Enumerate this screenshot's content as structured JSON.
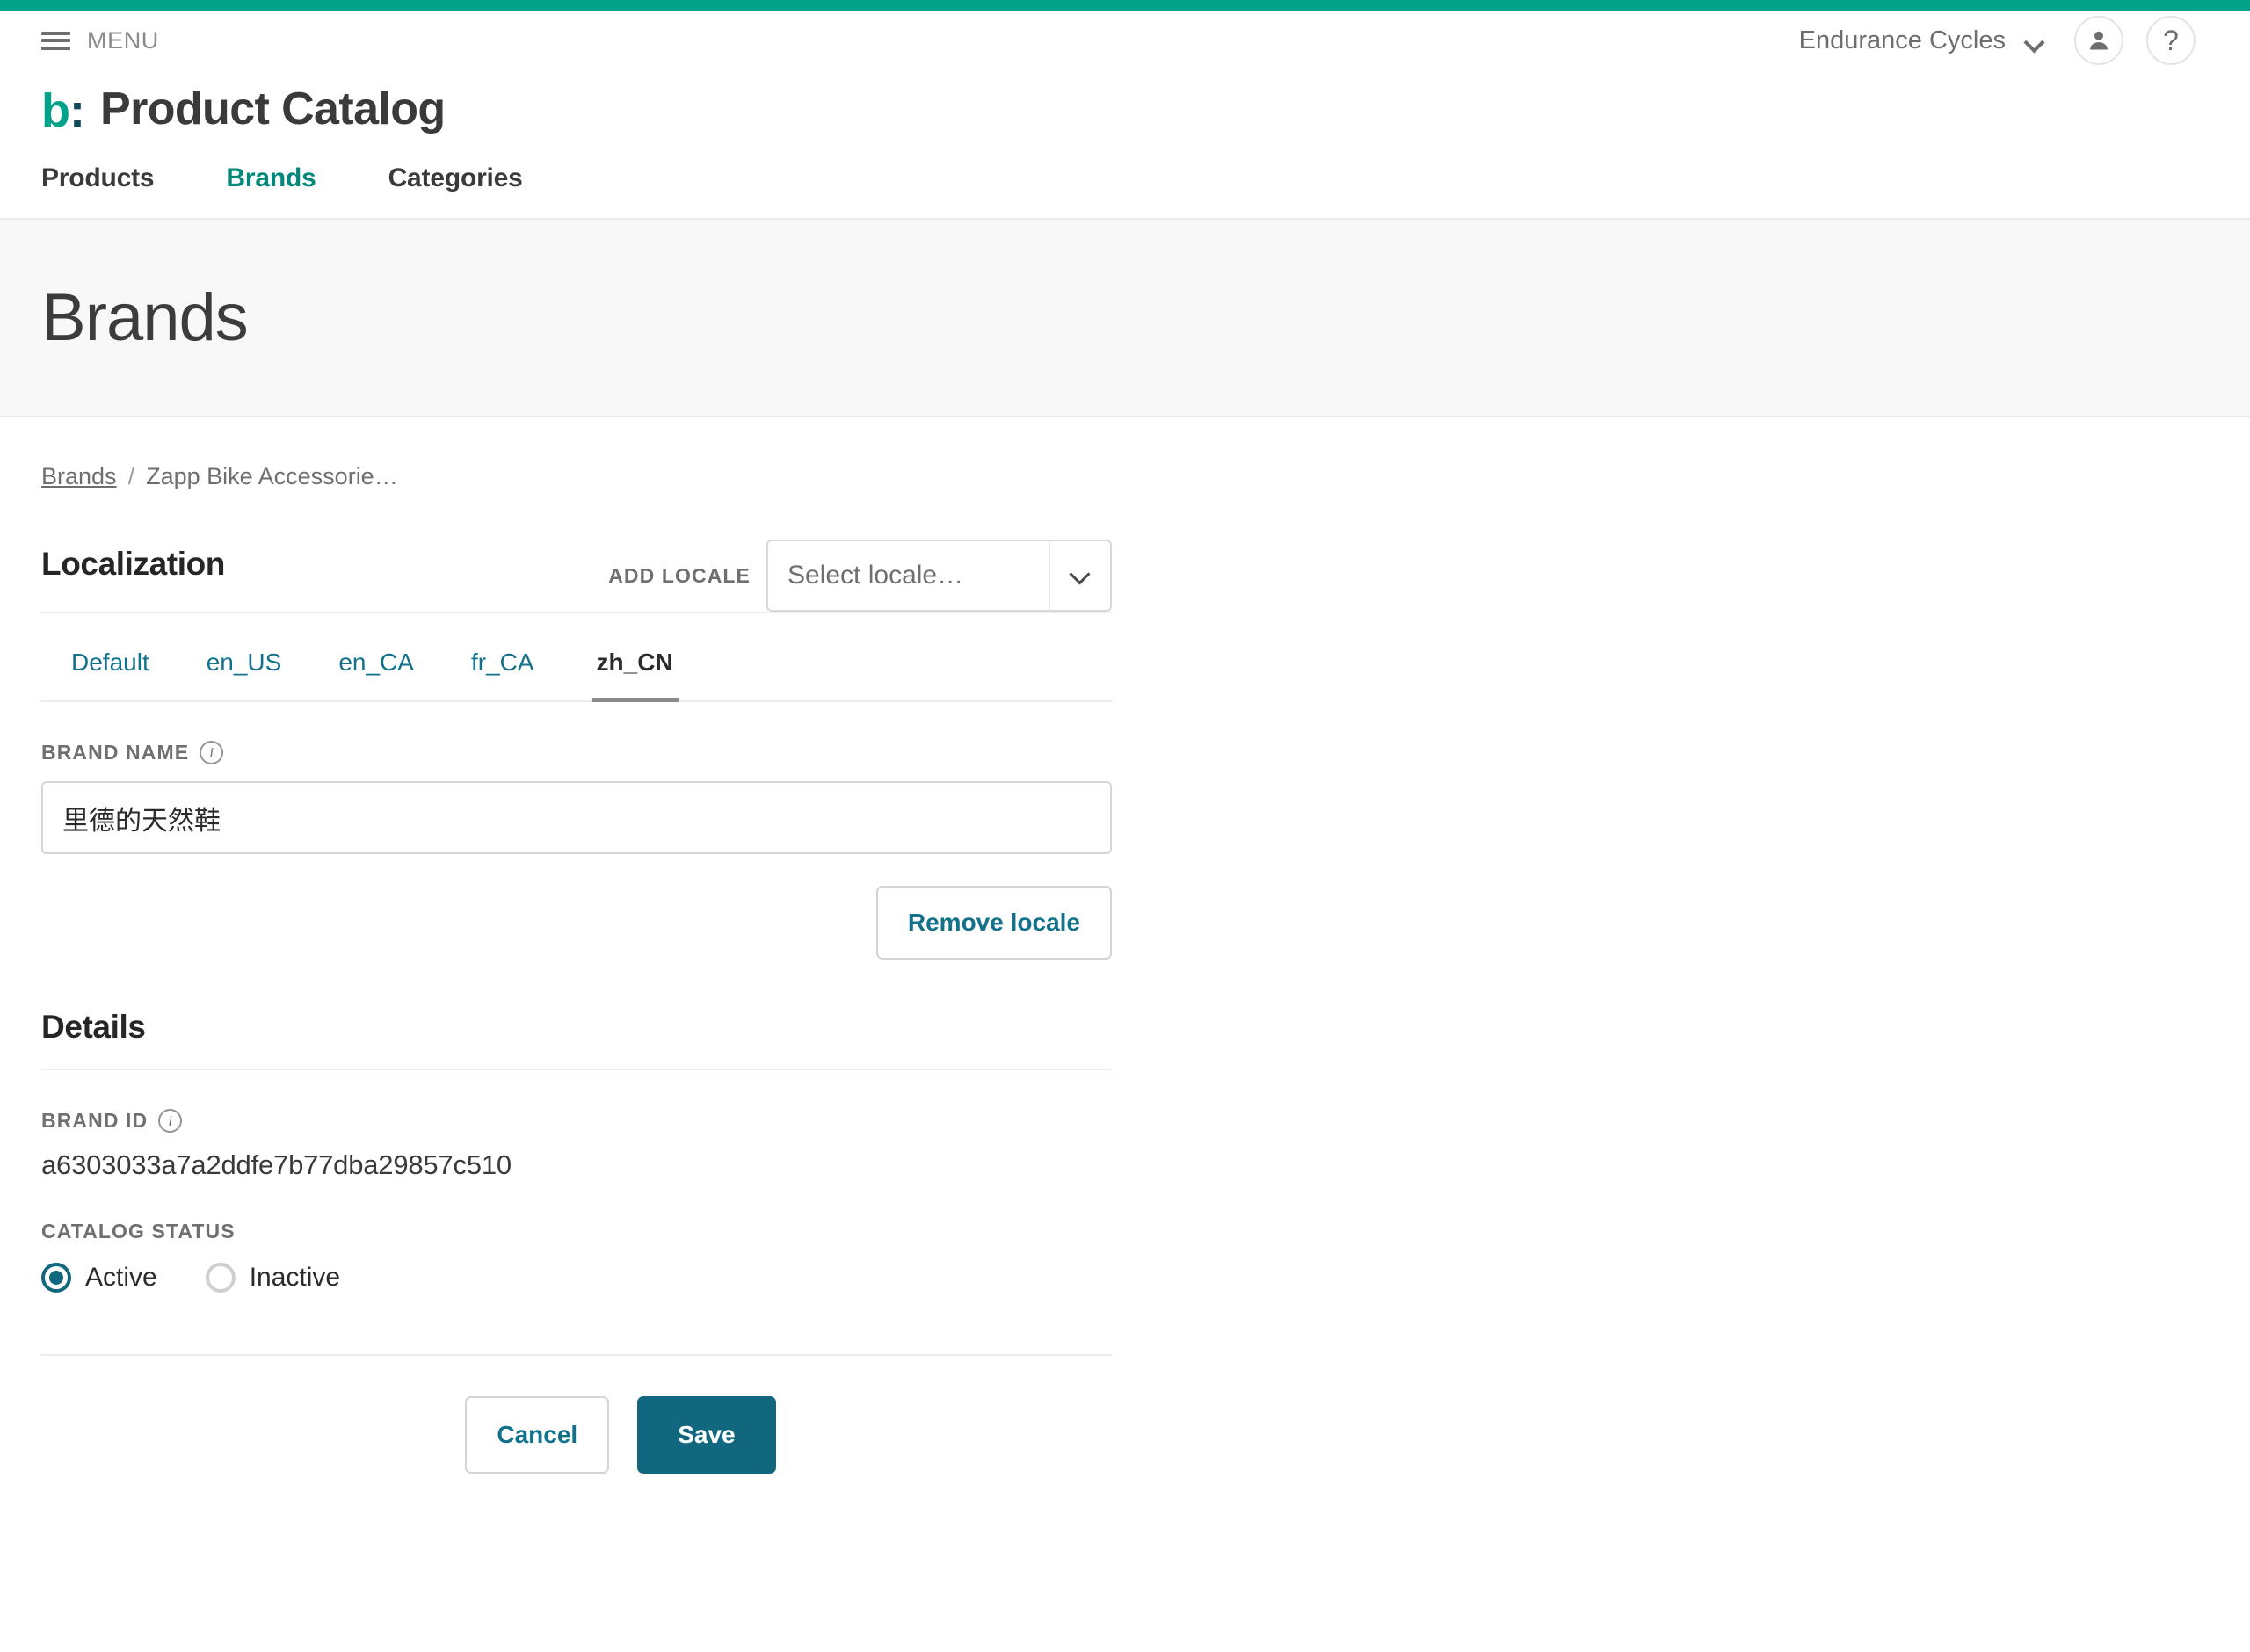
{
  "topbar": {
    "accent_color": "#00a389",
    "menu_label": "MENU",
    "org_name": "Endurance Cycles",
    "account_icon": "person-icon",
    "help_icon": "question-mark-icon"
  },
  "app": {
    "logo_mark": "b",
    "logo_colon": ":",
    "title": "Product Catalog"
  },
  "nav": {
    "items": [
      {
        "label": "Products",
        "active": false
      },
      {
        "label": "Brands",
        "active": true
      },
      {
        "label": "Categories",
        "active": false
      }
    ]
  },
  "page": {
    "title": "Brands"
  },
  "breadcrumb": {
    "root": "Brands",
    "separator": "/",
    "current": "Zapp Bike Accessorie…"
  },
  "localization": {
    "section_title": "Localization",
    "add_locale_label": "ADD LOCALE",
    "select": {
      "value": "Select locale…",
      "arrow_icon": "chevron-down-icon"
    },
    "tabs": [
      {
        "label": "Default",
        "active": false
      },
      {
        "label": "en_US",
        "active": false
      },
      {
        "label": "en_CA",
        "active": false
      },
      {
        "label": "fr_CA",
        "active": false
      },
      {
        "label": "zh_CN",
        "active": true
      }
    ],
    "brand_name": {
      "label": "BRAND NAME",
      "info_icon": "info-icon",
      "value": "里德的天然鞋",
      "placeholder": ""
    },
    "remove_locale_label": "Remove locale"
  },
  "details": {
    "section_title": "Details",
    "brand_id": {
      "label": "BRAND ID",
      "info_icon": "info-icon",
      "value": "a6303033a7a2ddfe7b77dba29857c510"
    },
    "catalog_status": {
      "label": "CATALOG STATUS",
      "options": [
        {
          "label": "Active",
          "selected": true
        },
        {
          "label": "Inactive",
          "selected": false
        }
      ]
    }
  },
  "footer": {
    "cancel_label": "Cancel",
    "save_label": "Save"
  },
  "colors": {
    "accent_teal": "#00a389",
    "brand_teal": "#00887a",
    "primary_button": "#11687e",
    "link_blue": "#12728c"
  }
}
